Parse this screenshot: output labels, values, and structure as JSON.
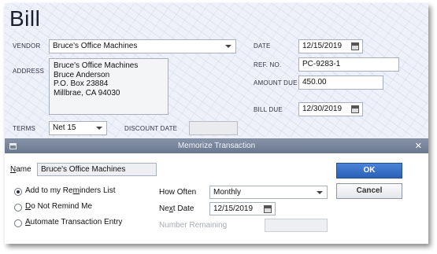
{
  "form": {
    "title": "Bill",
    "vendor_label": "VENDOR",
    "vendor_value": "Bruce's Office Machines",
    "address_label": "ADDRESS",
    "address_lines": [
      "Bruce's Office Machines",
      "Bruce Anderson",
      "P.O. Box 23884",
      "Millbrae, CA 94030"
    ],
    "terms_label": "TERMS",
    "terms_value": "Net 15",
    "discount_date_label": "DISCOUNT DATE",
    "discount_date_value": "",
    "date_label": "DATE",
    "date_value": "12/15/2019",
    "ref_label": "REF. NO.",
    "ref_value": "PC-9283-1",
    "amount_due_label": "AMOUNT DUE",
    "amount_due_value": "450.00",
    "bill_due_label": "BILL DUE",
    "bill_due_value": "12/30/2019"
  },
  "dialog": {
    "title": "Memorize Transaction",
    "name_label_first": "N",
    "name_label_rest": "ame",
    "name_value": "Bruce's Office Machines",
    "ok_label": "OK",
    "cancel_label": "Cancel",
    "options": [
      {
        "pre": "Add to my Re",
        "ul": "m",
        "post": "inders List",
        "selected": true
      },
      {
        "pre": "",
        "ul": "D",
        "post": "o Not Remind Me",
        "selected": false
      },
      {
        "pre": "",
        "ul": "A",
        "post": "utomate Transaction Entry",
        "selected": false
      }
    ],
    "how_often_label": "How Often",
    "how_often_value": "Monthly",
    "next_date_label_pre": "Ne",
    "next_date_label_ul": "x",
    "next_date_label_post": "t Date",
    "next_date_value": "12/15/2019",
    "number_remaining_label": "Number Remaining"
  },
  "icons": {
    "dropdown": "chevron-down-icon",
    "calendar": "calendar-icon",
    "close": "close-icon",
    "window_menu": "window-menu-icon"
  }
}
